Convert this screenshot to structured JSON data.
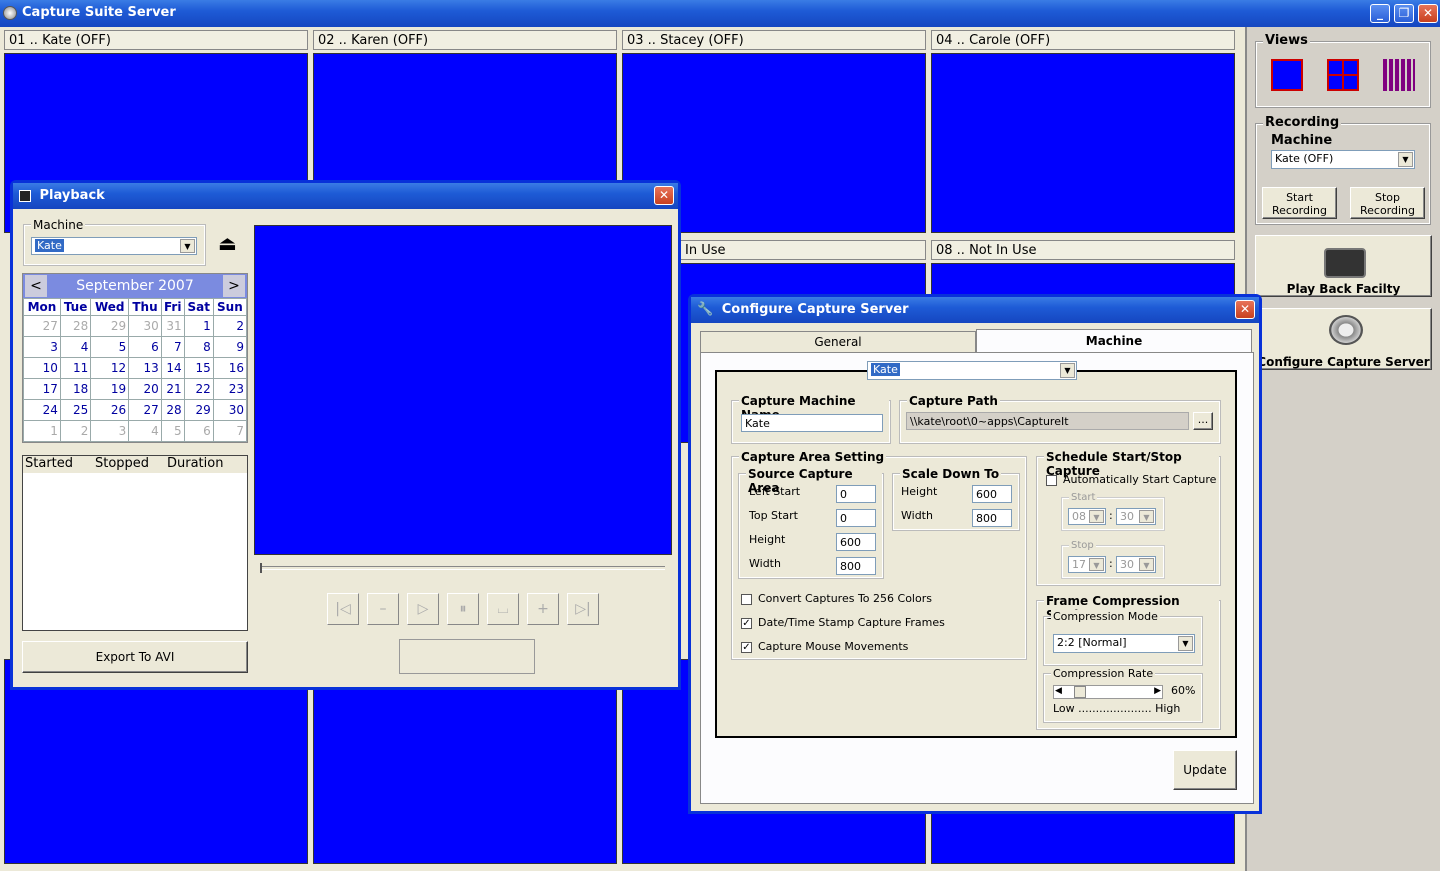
{
  "app": {
    "title": "Capture Suite Server"
  },
  "panes": [
    {
      "label": "01 .. Kate (OFF)"
    },
    {
      "label": "02 .. Karen (OFF)"
    },
    {
      "label": "03 .. Stacey (OFF)"
    },
    {
      "label": "04 .. Carole (OFF)"
    },
    {
      "label": "In Use"
    },
    {
      "label": "08 .. Not In Use"
    }
  ],
  "side": {
    "views_label": "Views",
    "recording_label": "Recording",
    "machine_label": "Machine",
    "machine_value": "Kate (OFF)",
    "start_recording": "Start Recording",
    "stop_recording": "Stop Recording",
    "playback_facility": "Play Back Facilty",
    "configure_server": "Configure Capture Server"
  },
  "playback": {
    "title": "Playback",
    "machine_label": "Machine",
    "machine_value": "Kate",
    "month": "September 2007",
    "prev": "<",
    "next": ">",
    "weekdays": [
      "Mon",
      "Tue",
      "Wed",
      "Thu",
      "Fri",
      "Sat",
      "Sun"
    ],
    "weeks": [
      [
        "27",
        "28",
        "29",
        "30",
        "31",
        "1",
        "2"
      ],
      [
        "3",
        "4",
        "5",
        "6",
        "7",
        "8",
        "9"
      ],
      [
        "10",
        "11",
        "12",
        "13",
        "14",
        "15",
        "16"
      ],
      [
        "17",
        "18",
        "19",
        "20",
        "21",
        "22",
        "23"
      ],
      [
        "24",
        "25",
        "26",
        "27",
        "28",
        "29",
        "30"
      ],
      [
        "1",
        "2",
        "3",
        "4",
        "5",
        "6",
        "7"
      ]
    ],
    "list_headers": [
      "Started",
      "Stopped",
      "Duration"
    ],
    "export_label": "Export To AVI"
  },
  "configure": {
    "title": "Configure Capture Server",
    "tabs": [
      "General",
      "Machine"
    ],
    "machine_select": "Kate",
    "machine_name_label": "Capture Machine Name",
    "machine_name_value": "Kate",
    "path_label": "Capture Path",
    "path_value": "\\\\kate\\root\\0~apps\\CaptureIt",
    "browse": "...",
    "area_setting_label": "Capture Area Setting",
    "source_area_label": "Source Capture Area",
    "left_start_label": "Left Start",
    "left_start_value": "0",
    "top_start_label": "Top Start",
    "top_start_value": "0",
    "height_label": "Height",
    "height_value": "600",
    "width_label": "Width",
    "width_value": "800",
    "scale_label": "Scale Down To",
    "scale_height_value": "600",
    "scale_width_value": "800",
    "convert_256": "Convert Captures To 256 Colors",
    "datetime_stamp": "Date/Time Stamp Capture Frames",
    "mouse_movements": "Capture Mouse Movements",
    "schedule_label": "Schedule Start/Stop Capture",
    "auto_start": "Automatically Start Capture",
    "start_label": "Start",
    "start_hour": "08",
    "start_min": "30",
    "stop_label": "Stop",
    "stop_hour": "17",
    "stop_min": "30",
    "colon": ":",
    "compression_label": "Frame Compression Settings",
    "mode_label": "Compression Mode",
    "mode_value": "2:2 [Normal]",
    "rate_label": "Compression Rate",
    "rate_value": "60%",
    "rate_fraction": 0.1,
    "low_high": "Low ..................... High",
    "update": "Update"
  },
  "colors": {
    "video": "#0000ff",
    "titlebar": "#1e5bd6"
  }
}
